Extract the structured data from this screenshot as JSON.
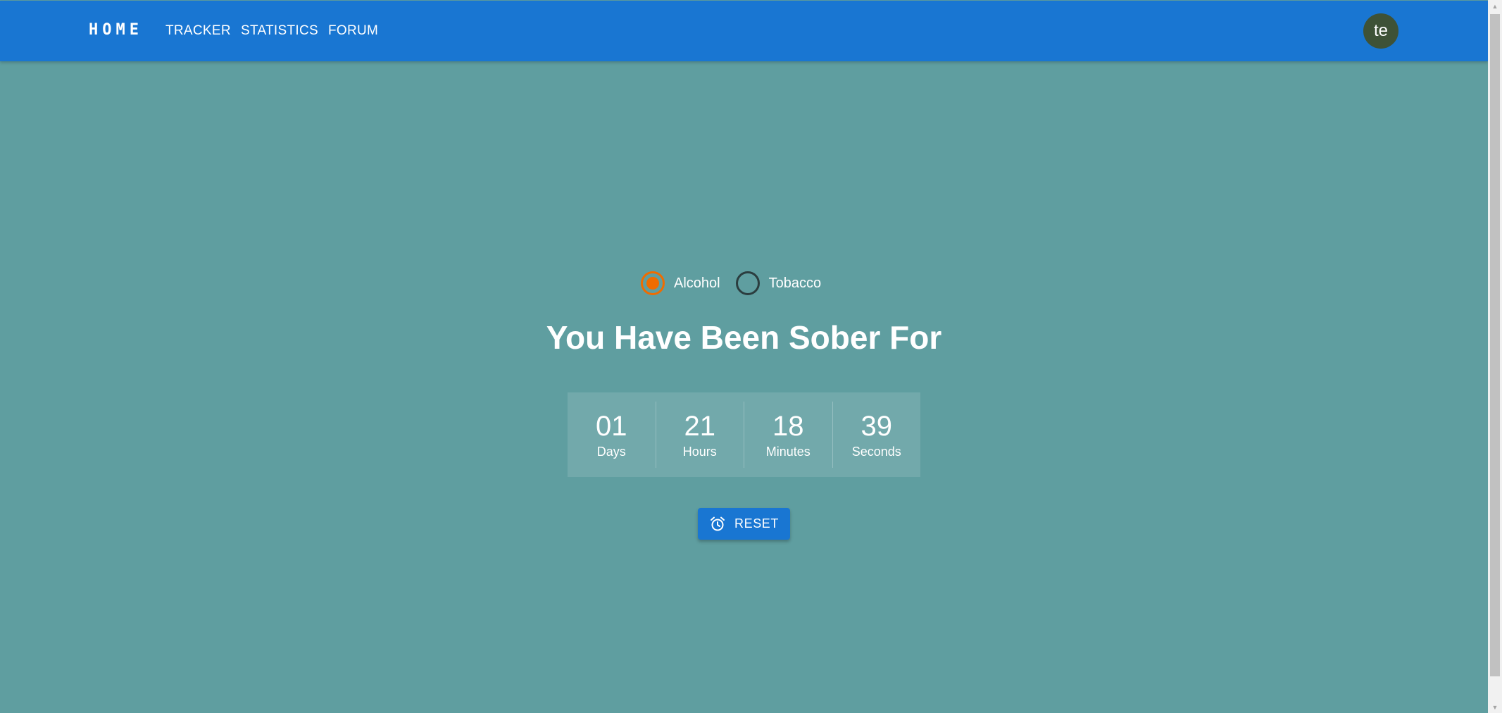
{
  "nav": {
    "brand": "HOME",
    "links": [
      "TRACKER",
      "STATISTICS",
      "FORUM"
    ],
    "avatar_initials": "te",
    "avatar_color": "#3e5237",
    "bar_color": "#1976d2"
  },
  "page": {
    "background_color": "#5f9ea0"
  },
  "substance_selector": {
    "selected": "Alcohol",
    "accent_color": "#ef6c00",
    "options": [
      {
        "label": "Alcohol",
        "checked": true
      },
      {
        "label": "Tobacco",
        "checked": false
      }
    ]
  },
  "headline": "You Have Been Sober For",
  "timer": [
    {
      "value": "01",
      "label": "Days"
    },
    {
      "value": "21",
      "label": "Hours"
    },
    {
      "value": "18",
      "label": "Minutes"
    },
    {
      "value": "39",
      "label": "Seconds"
    }
  ],
  "reset_button": {
    "label": "RESET",
    "icon": "alarm-clock-icon"
  }
}
